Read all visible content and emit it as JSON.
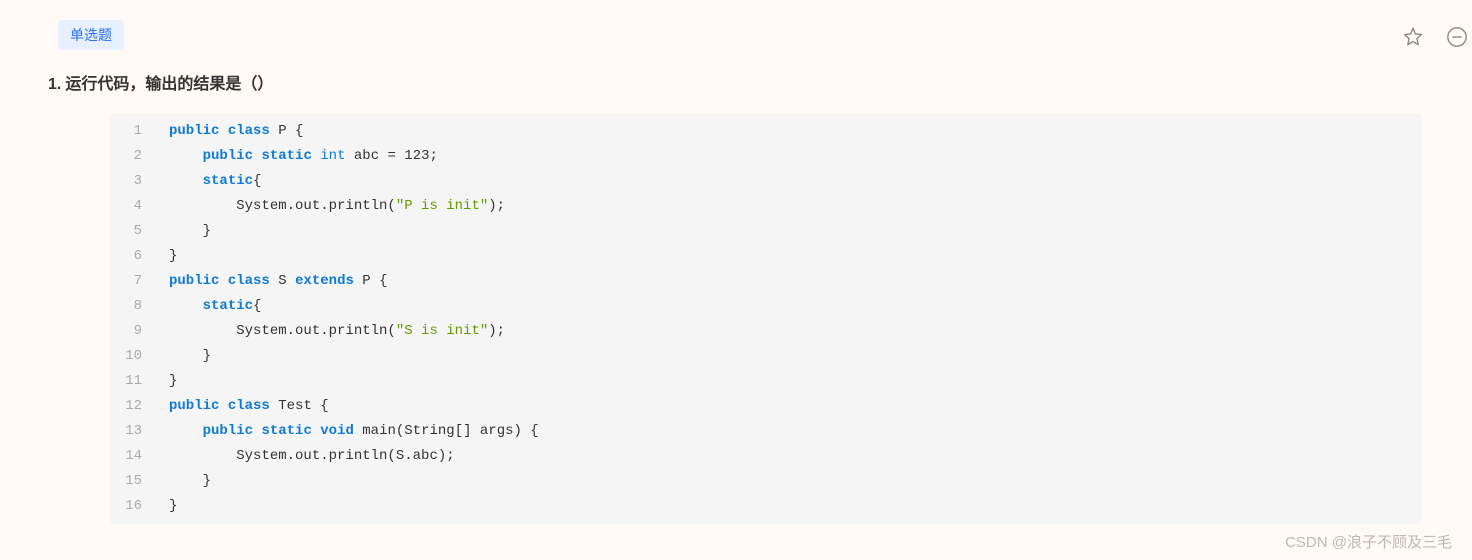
{
  "tag": "单选题",
  "question": {
    "number": "1.",
    "title": "运行代码，输出的结果是（）"
  },
  "code": {
    "lines": [
      {
        "n": "1",
        "tokens": [
          {
            "t": "public",
            "c": "kw"
          },
          {
            "t": " "
          },
          {
            "t": "class",
            "c": "kw"
          },
          {
            "t": " P {"
          }
        ]
      },
      {
        "n": "2",
        "indent": 1,
        "tokens": [
          {
            "t": "public",
            "c": "kw"
          },
          {
            "t": " "
          },
          {
            "t": "static",
            "c": "kw"
          },
          {
            "t": " "
          },
          {
            "t": "int",
            "c": "type"
          },
          {
            "t": " abc = 123;"
          }
        ]
      },
      {
        "n": "3",
        "indent": 1,
        "tokens": [
          {
            "t": "static",
            "c": "kw"
          },
          {
            "t": "{"
          }
        ]
      },
      {
        "n": "4",
        "indent": 2,
        "tokens": [
          {
            "t": "System.out.println("
          },
          {
            "t": "\"P is init\"",
            "c": "str"
          },
          {
            "t": ");"
          }
        ]
      },
      {
        "n": "5",
        "indent": 1,
        "tokens": [
          {
            "t": "}"
          }
        ]
      },
      {
        "n": "6",
        "tokens": [
          {
            "t": "}"
          }
        ]
      },
      {
        "n": "7",
        "tokens": [
          {
            "t": "public",
            "c": "kw"
          },
          {
            "t": " "
          },
          {
            "t": "class",
            "c": "kw"
          },
          {
            "t": " S "
          },
          {
            "t": "extends",
            "c": "kw"
          },
          {
            "t": " P {"
          }
        ]
      },
      {
        "n": "8",
        "indent": 1,
        "tokens": [
          {
            "t": "static",
            "c": "kw"
          },
          {
            "t": "{"
          }
        ]
      },
      {
        "n": "9",
        "indent": 2,
        "tokens": [
          {
            "t": "System.out.println("
          },
          {
            "t": "\"S is init\"",
            "c": "str"
          },
          {
            "t": ");"
          }
        ]
      },
      {
        "n": "10",
        "indent": 1,
        "tokens": [
          {
            "t": "}"
          }
        ]
      },
      {
        "n": "11",
        "tokens": [
          {
            "t": "}"
          }
        ]
      },
      {
        "n": "12",
        "tokens": [
          {
            "t": "public",
            "c": "kw"
          },
          {
            "t": " "
          },
          {
            "t": "class",
            "c": "kw"
          },
          {
            "t": " Test {"
          }
        ]
      },
      {
        "n": "13",
        "indent": 1,
        "tokens": [
          {
            "t": "public",
            "c": "kw"
          },
          {
            "t": " "
          },
          {
            "t": "static",
            "c": "kw"
          },
          {
            "t": " "
          },
          {
            "t": "void",
            "c": "kw"
          },
          {
            "t": " main(String[] args) {"
          }
        ]
      },
      {
        "n": "14",
        "indent": 2,
        "tokens": [
          {
            "t": "System.out.println(S.abc);"
          }
        ]
      },
      {
        "n": "15",
        "indent": 1,
        "tokens": [
          {
            "t": "}"
          }
        ]
      },
      {
        "n": "16",
        "tokens": [
          {
            "t": "}"
          }
        ]
      }
    ]
  },
  "watermark": "CSDN @浪子不顾及三毛"
}
